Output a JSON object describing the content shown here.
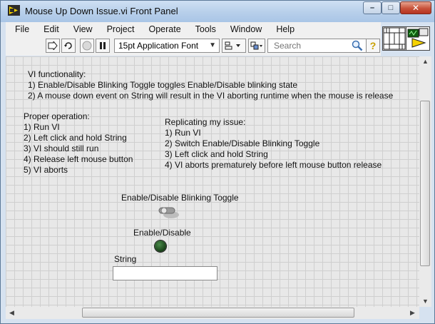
{
  "window": {
    "title": "Mouse Up Down Issue.vi Front Panel",
    "minimize": "–",
    "maximize": "□",
    "close": "✕"
  },
  "menu": [
    "File",
    "Edit",
    "View",
    "Project",
    "Operate",
    "Tools",
    "Window",
    "Help"
  ],
  "toolbar": {
    "font": "15pt Application Font",
    "search_placeholder": "Search",
    "help": "?"
  },
  "panel": {
    "description": "VI functionality:\n1) Enable/Disable Blinking Toggle toggles Enable/Disable blinking state\n2) A mouse down event on String will result in the VI aborting runtime when the mouse is release",
    "proper_operation": "Proper operation:\n1) Run VI\n2) Left click and hold String\n3) VI should still run\n4) Release left mouse button\n5) VI aborts",
    "replicating_issue": "Replicating my issue:\n1) Run VI\n2) Switch Enable/Disable Blinking Toggle\n3) Left click and hold String\n4) VI aborts prematurely before left mouse button release",
    "toggle_label": "Enable/Disable Blinking Toggle",
    "led_label": "Enable/Disable",
    "string_label": "String",
    "string_value": ""
  },
  "colors": {
    "panel_bg": "#e8e8e8",
    "grid": "#cfcfcf",
    "led_off": "#1f4a1f"
  }
}
